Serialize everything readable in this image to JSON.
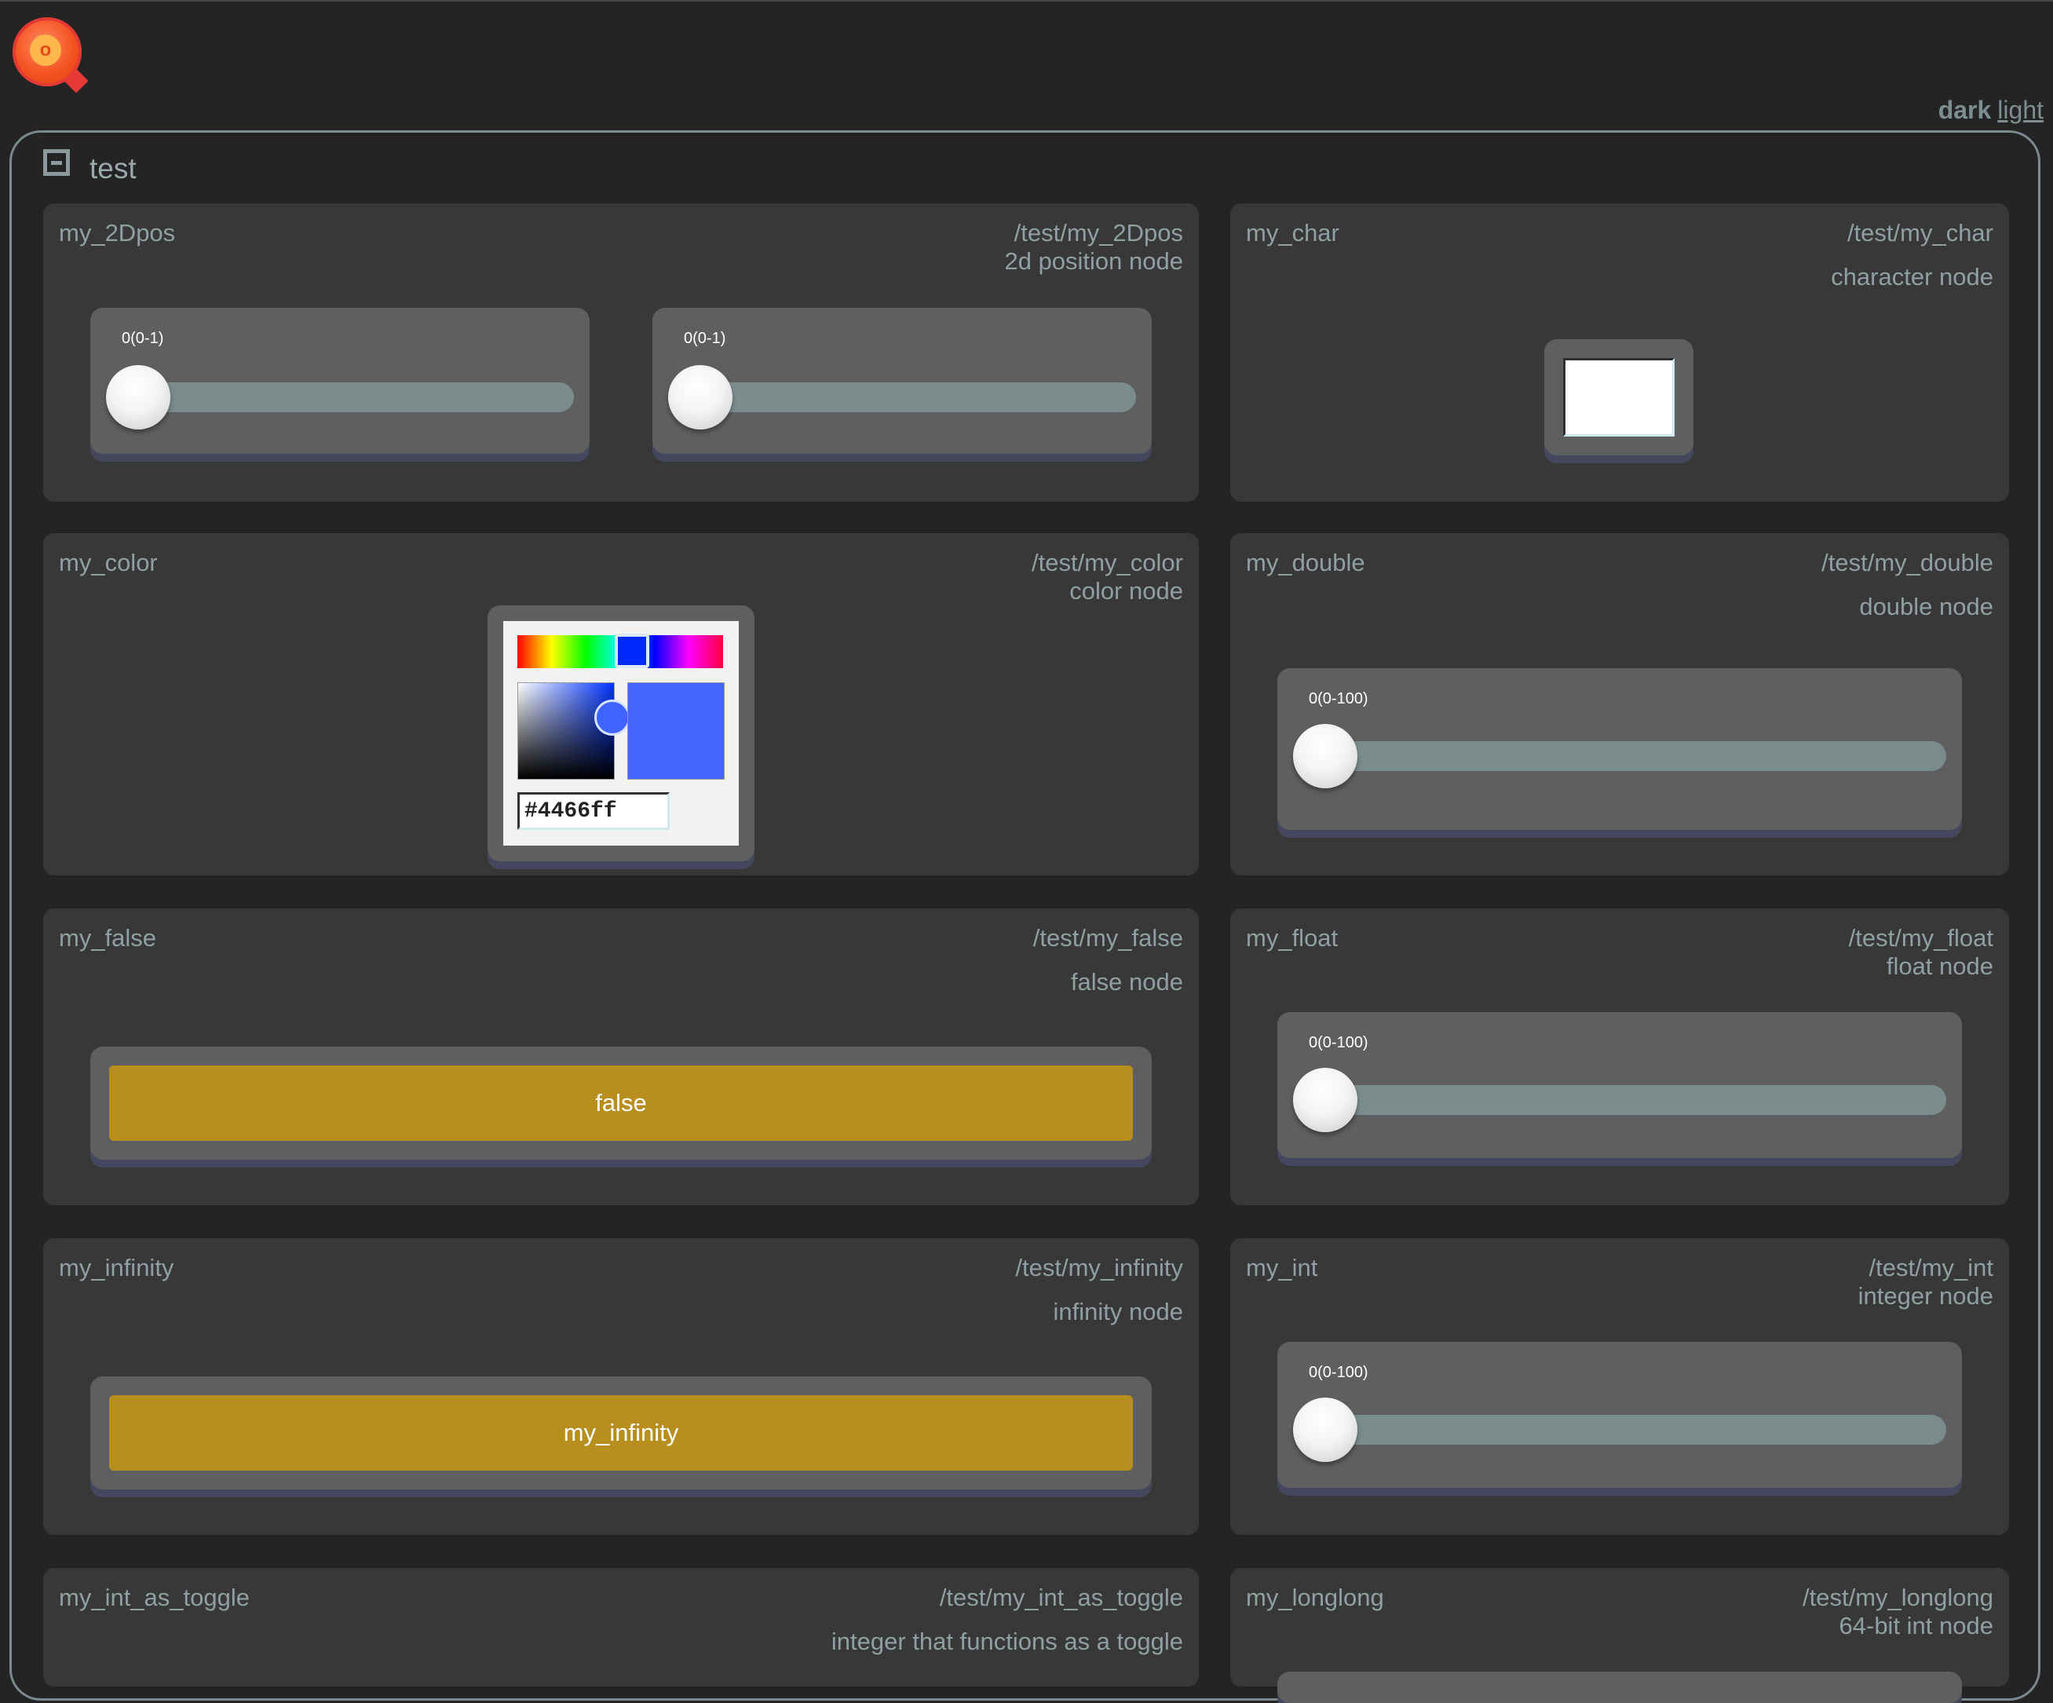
{
  "theme": {
    "dark": "dark",
    "light": "light"
  },
  "group": {
    "title": "test"
  },
  "nodes": {
    "my_2Dpos": {
      "name": "my_2Dpos",
      "path": "/test/my_2Dpos",
      "desc": "2d position node",
      "slider_x": "0(0-1)",
      "slider_y": "0(0-1)",
      "value_x": 0,
      "value_y": 0
    },
    "my_char": {
      "name": "my_char",
      "path": "/test/my_char",
      "desc": "character node",
      "value": ""
    },
    "my_color": {
      "name": "my_color",
      "path": "/test/my_color",
      "desc": "color node",
      "hex": "#4466ff"
    },
    "my_double": {
      "name": "my_double",
      "path": "/test/my_double",
      "desc": "double node",
      "slider": "0(0-100)",
      "value": 0
    },
    "my_false": {
      "name": "my_false",
      "path": "/test/my_false",
      "desc": "false node",
      "button": "false"
    },
    "my_float": {
      "name": "my_float",
      "path": "/test/my_float",
      "desc": "float node",
      "slider": "0(0-100)",
      "value": 0
    },
    "my_infinity": {
      "name": "my_infinity",
      "path": "/test/my_infinity",
      "desc": "infinity node",
      "button": "my_infinity"
    },
    "my_int": {
      "name": "my_int",
      "path": "/test/my_int",
      "desc": "integer node",
      "slider": "0(0-100)",
      "value": 0
    },
    "my_int_as_toggle": {
      "name": "my_int_as_toggle",
      "path": "/test/my_int_as_toggle",
      "desc": "integer that functions as a toggle"
    },
    "my_longlong": {
      "name": "my_longlong",
      "path": "/test/my_longlong",
      "desc": "64-bit int node"
    }
  },
  "colors": {
    "background": "#242424",
    "card": "#383838",
    "widget": "#5f5f5f",
    "button": "#b88e1f",
    "track": "#7b8c8d",
    "text": "#8fa0a3"
  },
  "icons": {
    "logo": "app-logo-icon",
    "collapse": "collapse-icon"
  }
}
